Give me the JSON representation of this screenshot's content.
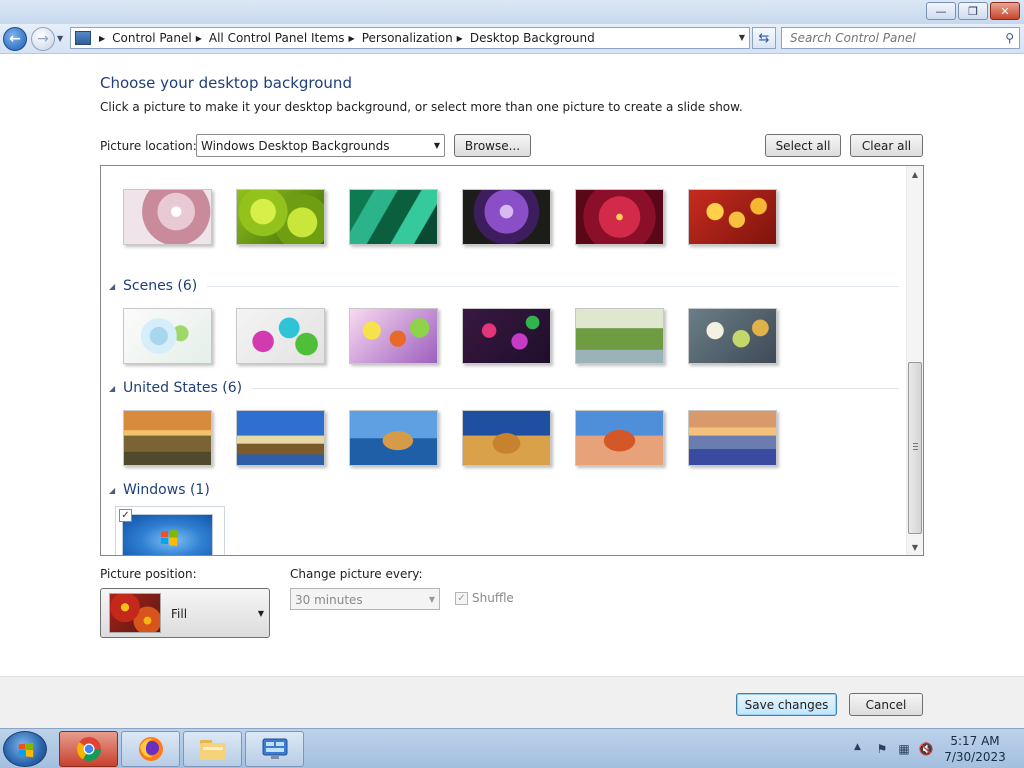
{
  "window": {
    "caption": {
      "minimize": "—",
      "restore": "❐",
      "close": "✕"
    }
  },
  "navbar": {
    "breadcrumb": [
      "Control Panel",
      "All Control Panel Items",
      "Personalization",
      "Desktop Background"
    ],
    "search_placeholder": "Search Control Panel"
  },
  "main": {
    "heading": "Choose your desktop background",
    "subtext": "Click a picture to make it your desktop background, or select more than one picture to create a slide show.",
    "picture_location_label": "Picture location:",
    "picture_location_value": "Windows Desktop Backgrounds",
    "browse_label": "Browse...",
    "select_all_label": "Select all",
    "clear_all_label": "Clear all"
  },
  "gallery": {
    "groups": [
      {
        "title": "Scenes (6)"
      },
      {
        "title": "United States (6)"
      },
      {
        "title": "Windows (1)"
      }
    ],
    "windows_item_checked": "✓"
  },
  "options": {
    "picture_position_label": "Picture position:",
    "picture_position_value": "Fill",
    "change_picture_label": "Change picture every:",
    "change_picture_value": "30 minutes",
    "shuffle_label": "Shuffle",
    "shuffle_checked": "✓"
  },
  "footer": {
    "save_label": "Save changes",
    "cancel_label": "Cancel"
  },
  "taskbar": {
    "time": "5:17 AM",
    "date": "7/30/2023"
  }
}
